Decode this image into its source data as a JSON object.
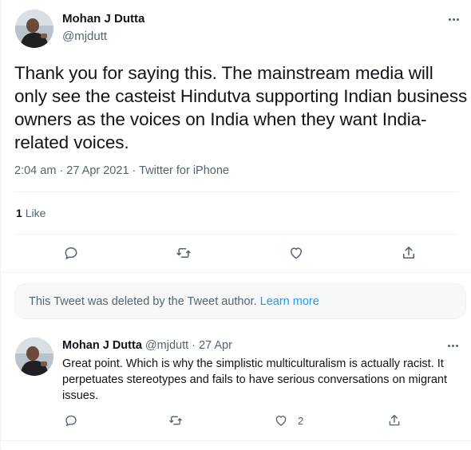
{
  "main_tweet": {
    "author_name": "Mohan J Dutta",
    "author_handle": "@mjdutt",
    "text": "Thank you for saying this. The mainstream media will only see the casteist Hindutva supporting Indian business owners as the voices on India when they want India-related voices.",
    "time": "2:04 am",
    "date": "27 Apr 2021",
    "source": "Twitter for iPhone",
    "like_count": "1",
    "like_label": "Like"
  },
  "deleted_notice": {
    "text": "This Tweet was deleted by the Tweet author.",
    "link": "Learn more"
  },
  "reply_tweet": {
    "author_name": "Mohan J Dutta",
    "author_handle": "@mjdutt",
    "date": "27 Apr",
    "text": "Great point. Which is why the simplistic multiculturalism is actually racist. It perpetuates stereotypes and fails to have serious conversations on migrant issues.",
    "like_count": "2"
  },
  "icons": {
    "reply": "reply-icon",
    "retweet": "retweet-icon",
    "like": "heart-icon",
    "share": "share-icon",
    "more": "more-icon"
  },
  "colors": {
    "link": "#1d9bf0",
    "secondary_text": "#536471",
    "primary_text": "#0f1419"
  }
}
